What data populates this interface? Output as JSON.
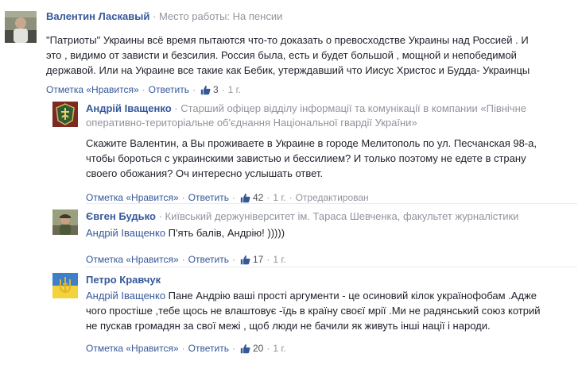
{
  "comments": [
    {
      "author": "Валентин Ласкавый",
      "meta": "Место работы: На пенсии",
      "text_lines": [
        "\"Патриоты\" Украины всё время пытаются что-то доказать о превосходстве Украины над Россией . И",
        "это , видимо от зависти и безсилия. Россия была, есть и будет большой , мощной и непобедимой",
        "державой. Или на Украине все такие как Бебик, утерждавший что Иисус Христос и Будда- Украинцы"
      ],
      "actions": {
        "like_label": "Отметка «Нравится»",
        "reply_label": "Ответить",
        "likes": "3",
        "time": "1 г.",
        "edited": ""
      },
      "avatar_icon": "person-photo-icon"
    },
    {
      "author": "Андрій Іващенко",
      "meta_lines": [
        "Старший офіцер відділу інформації та комунікації в компании «Північне",
        "оперативно-територіальне об'єднання Національної гвардії України»"
      ],
      "text_lines": [
        "Скажите Валентин, а Вы проживаете в Украине в городе Мелитополь по ул. Песчанская 98-а,",
        "чтобы бороться с украинскими завистью и бессилием? И только поэтому не едете в страну",
        "своего обожания? Оч интересно услышать ответ."
      ],
      "actions": {
        "like_label": "Отметка «Нравится»",
        "reply_label": "Ответить",
        "likes": "42",
        "time": "1 г.",
        "edited": "Отредактирован"
      },
      "avatar_icon": "national-guard-emblem-icon"
    },
    {
      "author": "Євген Будько",
      "meta": "Київський держуніверситет ім. Тараса Шевченка, факультет журналістики",
      "mention": "Андрій Іващенко",
      "text_after_mention": " П'ять балів, Андрію! )))))",
      "actions": {
        "like_label": "Отметка «Нравится»",
        "reply_label": "Ответить",
        "likes": "17",
        "time": "1 г.",
        "edited": ""
      },
      "avatar_icon": "person-photo-icon"
    },
    {
      "author": "Петро Кравчук",
      "meta": "",
      "mention": "Андрій Іващенко",
      "text_first_after_mention": " Пане Андрію ваші прості аргументи - це осиновий кілок українофобам .Адже",
      "text_lines": [
        "чого простіше ,тебе щось не влаштовує -їдь в країну своєї мрії .Ми не радянський союз котрий",
        "не пускав громадян за свої межі , щоб люди не бачили як живуть інші нації і народи."
      ],
      "actions": {
        "like_label": "Отметка «Нравится»",
        "reply_label": "Ответить",
        "likes": "20",
        "time": "1 г.",
        "edited": ""
      },
      "avatar_icon": "trident-flag-icon"
    }
  ],
  "separator": "·",
  "colors": {
    "link": "#365899",
    "meta": "#90949c",
    "text": "#1d2129"
  }
}
